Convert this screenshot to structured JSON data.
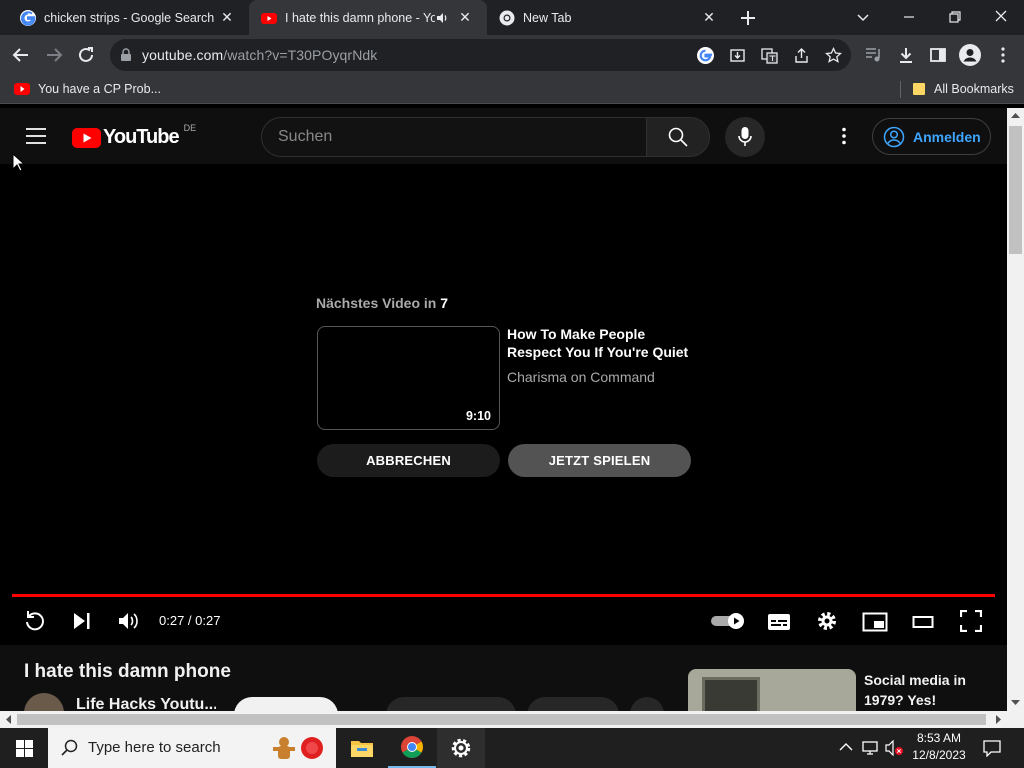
{
  "browser": {
    "tabs": [
      {
        "title": "chicken strips - Google Search",
        "favicon": "google-icon"
      },
      {
        "title": "I hate this damn phone - YouTube",
        "favicon": "youtube-icon",
        "audio": true
      },
      {
        "title": "New Tab",
        "favicon": "chrome-icon"
      }
    ],
    "url_host": "youtube.com",
    "url_path": "/watch?v=T30POyqrNdk",
    "bookmarks": [
      {
        "title": "You have a CP Prob..."
      }
    ],
    "all_bookmarks_label": "All Bookmarks"
  },
  "youtube": {
    "logo_text": "YouTube",
    "region": "DE",
    "search_placeholder": "Suchen",
    "signin_label": "Anmelden",
    "player": {
      "up_next_prefix": "Nächstes Video in",
      "countdown": "7",
      "next_video": {
        "title": "How To Make People Respect You If You're Quiet",
        "channel": "Charisma on Command",
        "duration": "9:10"
      },
      "cancel_label": "ABBRECHEN",
      "play_now_label": "JETZT SPIELEN",
      "time_display": "0:27 / 0:27",
      "progress": 1.0,
      "accent_color": "#ff0000"
    },
    "video_title": "I hate this damn phone",
    "channel_name": "Life Hacks Youtu...",
    "recommended": {
      "title": "Social media in 1979? Yes!"
    }
  },
  "taskbar": {
    "search_placeholder": "Type here to search",
    "time": "8:53 AM",
    "date": "12/8/2023"
  }
}
